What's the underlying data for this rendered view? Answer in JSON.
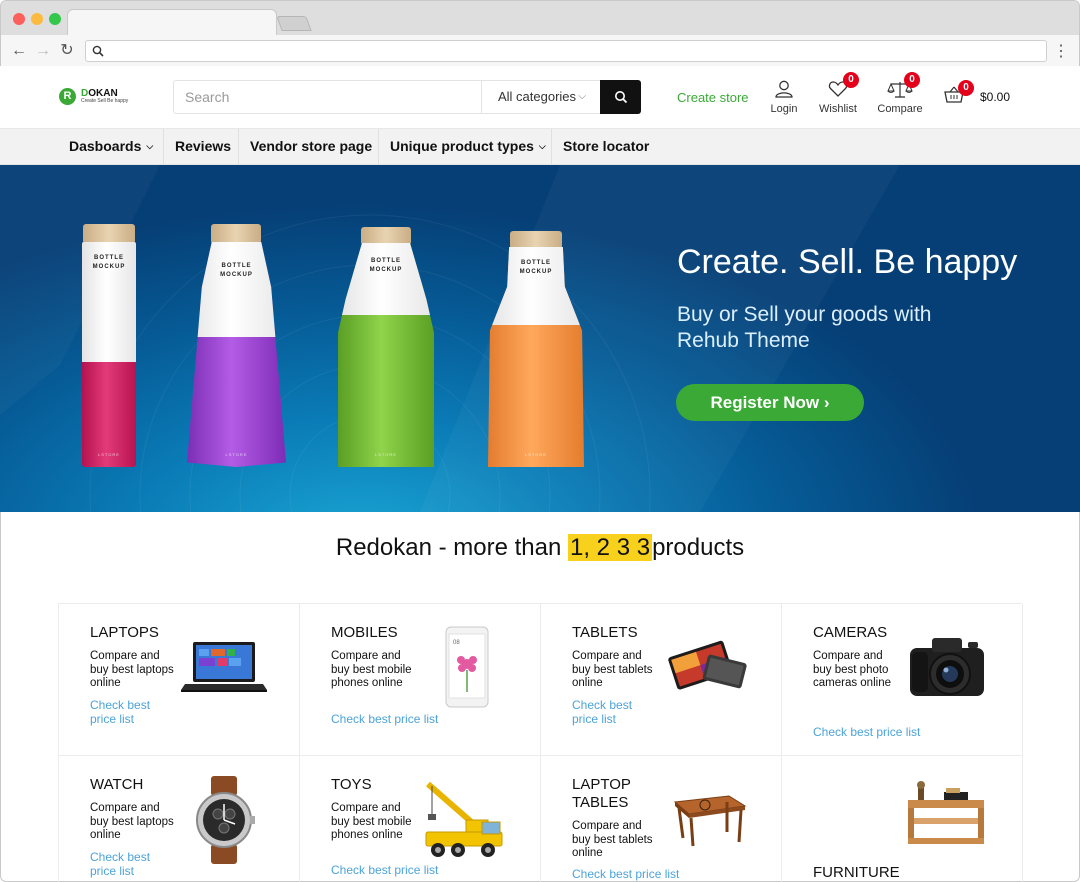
{
  "browser": {
    "url": ""
  },
  "header": {
    "logo_name_a": "D",
    "logo_name_b": "OKAN",
    "logo_badge": "R",
    "logo_tagline": "Create Sell Be happy",
    "search_placeholder": "Search",
    "category_select": "All categories",
    "create_store": "Create store",
    "login": "Login",
    "wishlist": "Wishlist",
    "wishlist_count": "0",
    "compare": "Compare",
    "compare_count": "0",
    "cart_count": "0",
    "cart_total": "$0.00"
  },
  "menu": [
    {
      "label": "Dasboards",
      "dropdown": true
    },
    {
      "label": "Reviews",
      "dropdown": false
    },
    {
      "label": "Vendor store page",
      "dropdown": false
    },
    {
      "label": "Unique product types",
      "dropdown": true
    },
    {
      "label": "Store locator",
      "dropdown": false
    }
  ],
  "hero": {
    "title": "Create. Sell. Be happy",
    "subtitle": "Buy or Sell your goods with Rehub Theme",
    "cta": "Register Now",
    "bottle_label": "BOTTLE\nMOCKUP",
    "bottle_brand": "LSTORE",
    "colors": {
      "background": "#0a6fae",
      "cta": "#3ba935"
    }
  },
  "products_heading": {
    "before": "Redokan - more than ",
    "count": "1, 2 3 3",
    "after": "products"
  },
  "categories": [
    {
      "title": "LAPTOPS",
      "desc": "Compare and buy best laptops online",
      "link": "Check best price list",
      "icon": "laptop-image"
    },
    {
      "title": "MOBILES",
      "desc": "Compare and buy best mobile phones online",
      "link": "Check best price list",
      "icon": "mobile-phone-image"
    },
    {
      "title": "TABLETS",
      "desc": "Compare and buy best tablets online",
      "link": "Check best price list",
      "icon": "tablet-image"
    },
    {
      "title": "CAMERAS",
      "desc": "Compare and buy best photo cameras online",
      "link": "Check best price list",
      "icon": "camera-image"
    },
    {
      "title": "WATCH",
      "desc": "Compare and buy best laptops online",
      "link": "Check best price list",
      "icon": "watch-image"
    },
    {
      "title": "TOYS",
      "desc": "Compare and buy best mobile phones online",
      "link": "Check best price list",
      "icon": "toy-crane-image"
    },
    {
      "title": "LAPTOP TABLES",
      "desc": "Compare and buy best tablets online",
      "link": "Check best price list",
      "icon": "laptop-table-image"
    },
    {
      "title": "FURNITURE",
      "desc": "",
      "link": "",
      "icon": "furniture-image"
    }
  ],
  "colors": {
    "brand_green": "#3ba935",
    "link_blue": "#4ca3d9",
    "badge_red": "#e4001b",
    "highlight_yellow": "#f7d11c"
  }
}
